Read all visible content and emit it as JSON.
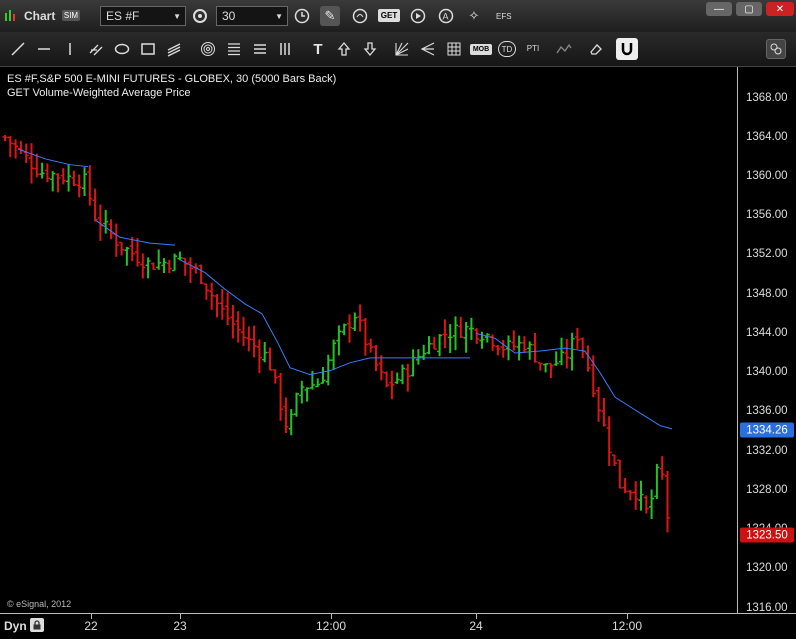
{
  "window": {
    "title": "Chart",
    "mode_badge": "SIM"
  },
  "toolbar": {
    "symbol_value": "ES #F",
    "interval_value": "30",
    "get_label": "GET",
    "efs_label": "EFS"
  },
  "drawing_tools": {
    "text_tool": "T",
    "mob_label": "MOB",
    "td_label": "TD",
    "pti_label": "PTI"
  },
  "chart": {
    "title_line1": "ES #F,S&P 500 E-MINI FUTURES - GLOBEX, 30 (5000 Bars Back)",
    "title_line2": "GET Volume-Weighted Average Price",
    "copyright": "© eSignal, 2012",
    "price_ticks": [
      "1368.00",
      "1364.00",
      "1360.00",
      "1356.00",
      "1352.00",
      "1348.00",
      "1344.00",
      "1340.00",
      "1336.00",
      "1332.00",
      "1328.00",
      "1324.00",
      "1320.00",
      "1316.00"
    ],
    "time_labels": [
      "22",
      "23",
      "12:00",
      "24",
      "12:00"
    ],
    "last_price_badge": "1323.50",
    "vwap_badge": "1334.26",
    "dyn_label": "Dyn"
  },
  "colors": {
    "up": "#22c322",
    "down": "#e01414",
    "vwap": "#3a7cff",
    "badge_red": "#cc1111",
    "badge_blue": "#2a6fe0"
  }
}
